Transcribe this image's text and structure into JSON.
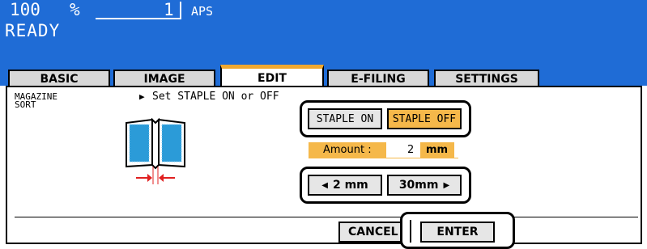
{
  "status": {
    "zoom_value": "100",
    "zoom_unit": "%",
    "copy_count": "1",
    "paper_mode": "APS",
    "state": "READY"
  },
  "tabs": [
    {
      "label": "BASIC"
    },
    {
      "label": "IMAGE"
    },
    {
      "label": "EDIT"
    },
    {
      "label": "E-FILING"
    },
    {
      "label": "SETTINGS"
    }
  ],
  "function": {
    "title_line1": "MAGAZINE",
    "title_line2": "SORT",
    "instruction_arrow": "▶",
    "instruction": "Set STAPLE ON or OFF"
  },
  "staple": {
    "on_label": "STAPLE ON",
    "off_label": "STAPLE OFF",
    "selected": "STAPLE OFF"
  },
  "amount": {
    "label": "Amount :",
    "value": "2",
    "unit": "mm"
  },
  "adjust": {
    "decrease_arrow": "◀",
    "decrease_label": "2 mm",
    "increase_label": "30mm",
    "increase_arrow": "▶"
  },
  "footer": {
    "cancel_label": "CANCEL",
    "enter_label": "ENTER"
  },
  "colors": {
    "header_bg": "#1f6cd6",
    "selected_orange": "#f5b84a",
    "active_tab_accent": "#f0a830",
    "arrow_red": "#e02020",
    "book_blue": "#2b9bd8"
  }
}
